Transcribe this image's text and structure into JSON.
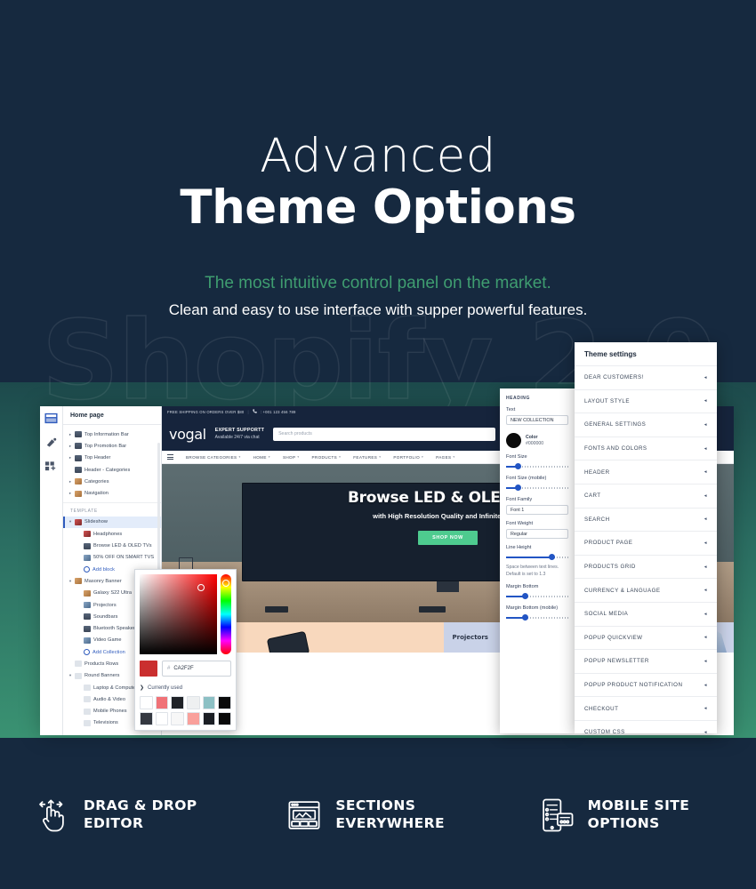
{
  "hero": {
    "title_light": "Advanced",
    "title_bold": "Theme Options",
    "subtitle_green": "The most intuitive control panel on the market.",
    "subtitle_white": "Clean and easy to use interface with supper powerful features.",
    "watermark": "Shopify 2.0",
    "accent_green": "#3f9d70",
    "background": "#16293f"
  },
  "editor": {
    "rail": [
      {
        "name": "sections-icon",
        "active": true
      },
      {
        "name": "theme-settings-icon",
        "active": false
      },
      {
        "name": "apps-icon",
        "active": false
      }
    ],
    "sidebar": {
      "page_title": "Home page",
      "template_label": "TEMPLATE",
      "items": [
        {
          "label": "Top Information Bar",
          "caret": "▸",
          "indent": 0,
          "icon": "dark"
        },
        {
          "label": "Top Promotion Bar",
          "caret": "▸",
          "indent": 0,
          "icon": "dark"
        },
        {
          "label": "Top Header",
          "caret": "▸",
          "indent": 0,
          "icon": "dark"
        },
        {
          "label": "Header - Categories",
          "caret": "",
          "indent": 0,
          "icon": "dark"
        },
        {
          "label": "Categories",
          "caret": "▸",
          "indent": 0,
          "icon": "warm"
        },
        {
          "label": "Navigation",
          "caret": "▸",
          "indent": 0,
          "icon": "warm"
        }
      ],
      "template_items": [
        {
          "label": "Slideshow",
          "caret": "▾",
          "indent": 0,
          "icon": "red",
          "selected": true
        },
        {
          "label": "Headphones",
          "caret": "",
          "indent": 1,
          "icon": "red"
        },
        {
          "label": "Browse LED & OLED TVs",
          "caret": "",
          "indent": 1,
          "icon": "dark"
        },
        {
          "label": "50% OFF ON SMART TVS",
          "caret": "",
          "indent": 1,
          "icon": "img"
        },
        {
          "label": "Add block",
          "caret": "",
          "indent": 1,
          "icon": "add",
          "link": true
        },
        {
          "label": "Masonry Banner",
          "caret": "▾",
          "indent": 0,
          "icon": "warm"
        },
        {
          "label": "Galaxy S22 Ultra",
          "caret": "",
          "indent": 1,
          "icon": "warm"
        },
        {
          "label": "Projectors",
          "caret": "",
          "indent": 1,
          "icon": "img"
        },
        {
          "label": "Soundbars",
          "caret": "",
          "indent": 1,
          "icon": "dark"
        },
        {
          "label": "Bluetooth Speaker",
          "caret": "",
          "indent": 1,
          "icon": "dark"
        },
        {
          "label": "Video Game",
          "caret": "",
          "indent": 1,
          "icon": "img"
        },
        {
          "label": "Add Collection",
          "caret": "",
          "indent": 1,
          "icon": "add",
          "link": true
        },
        {
          "label": "Products Rows",
          "caret": "",
          "indent": 0,
          "icon": "pale"
        },
        {
          "label": "Round Banners",
          "caret": "▾",
          "indent": 0,
          "icon": "pale"
        },
        {
          "label": "Laptop & Computers",
          "caret": "",
          "indent": 1,
          "icon": "pale"
        },
        {
          "label": "Audio & Video",
          "caret": "",
          "indent": 1,
          "icon": "pale"
        },
        {
          "label": "Mobile Phones",
          "caret": "",
          "indent": 1,
          "icon": "pale"
        },
        {
          "label": "Televisions",
          "caret": "",
          "indent": 1,
          "icon": "pale"
        }
      ]
    },
    "preview": {
      "topbar": {
        "shipping": "FREE SHIPPING ON ORDERS OVER $80",
        "separator": "|",
        "phone": ": +001 123 456 789"
      },
      "logo": "vogal",
      "support_title": "EXPERT SUPPORTT",
      "support_sub": "Available 24/7 via chat",
      "search_placeholder": "Search products",
      "nav": [
        "BROWSE CATEGORIES",
        "HOME",
        "SHOP",
        "PRODUCTS",
        "FEATURES",
        "PORTFOLIO",
        "PAGES"
      ],
      "slide": {
        "heading": "Browse LED & OLED TVs",
        "sub": "with High Resolution Quality and Infinite Detail.",
        "cta": "SHOP NOW",
        "cta_color": "#4ecb8f"
      },
      "band": {
        "projectors": "Projectors"
      }
    },
    "color_picker": {
      "hex_prefix": "#",
      "hex_value": "CA2F2F",
      "current_swatch": "#ca2f2f",
      "currently_used_label": "Currently used",
      "chevron": "❯",
      "swatches": [
        "#ffffff",
        "#f07277",
        "#1f2227",
        "#eef0f1",
        "#8cc0c4",
        "#0a0a0a",
        "#343840",
        "#ffffff",
        "#f7f7f7",
        "#f9a09b",
        "#1b1e24",
        "#0a0a0a"
      ]
    },
    "section_settings": {
      "title": "HEADING",
      "text_label": "Text",
      "text_value": "NEW COLLECTION",
      "color_name": "Color",
      "color_value": "#000000",
      "font_size_label": "Font Size",
      "font_size_mobile_label": "Font Size (mobile)",
      "font_family_label": "Font Family",
      "font_family_value": "Font 1",
      "font_weight_label": "Font Weight",
      "font_weight_value": "Regular",
      "line_height_label": "Line Height",
      "line_height_hint": "Space between text lines. Default is set to 1.3",
      "margin_bottom_label": "Margin Bottom",
      "margin_bottom_mobile_label": "Margin Bottom (mobile)"
    },
    "theme_settings": {
      "title": "Theme settings",
      "arrow": "◂",
      "rows": [
        "DEAR CUSTOMERS!",
        "LAYOUT STYLE",
        "GENERAL SETTINGS",
        "FONTS AND COLORS",
        "HEADER",
        "CART",
        "SEARCH",
        "PRODUCT PAGE",
        "PRODUCTS GRID",
        "CURRENCY & LANGUAGE",
        "SOCIAL MEDIA",
        "POPUP QUICKVIEW",
        "POPUP NEWSLETTER",
        "POPUP PRODUCT NOTIFICATION",
        "CHECKOUT",
        "CUSTOM CSS"
      ]
    }
  },
  "features": [
    {
      "icon": "drag-drop-hand-icon",
      "line1": "DRAG & DROP",
      "line2": "EDITOR"
    },
    {
      "icon": "sections-layout-icon",
      "line1": "SECTIONS",
      "line2": "EVERYWHERE"
    },
    {
      "icon": "mobile-site-icon",
      "line1": "MOBILE SITE",
      "line2": "OPTIONS"
    }
  ]
}
